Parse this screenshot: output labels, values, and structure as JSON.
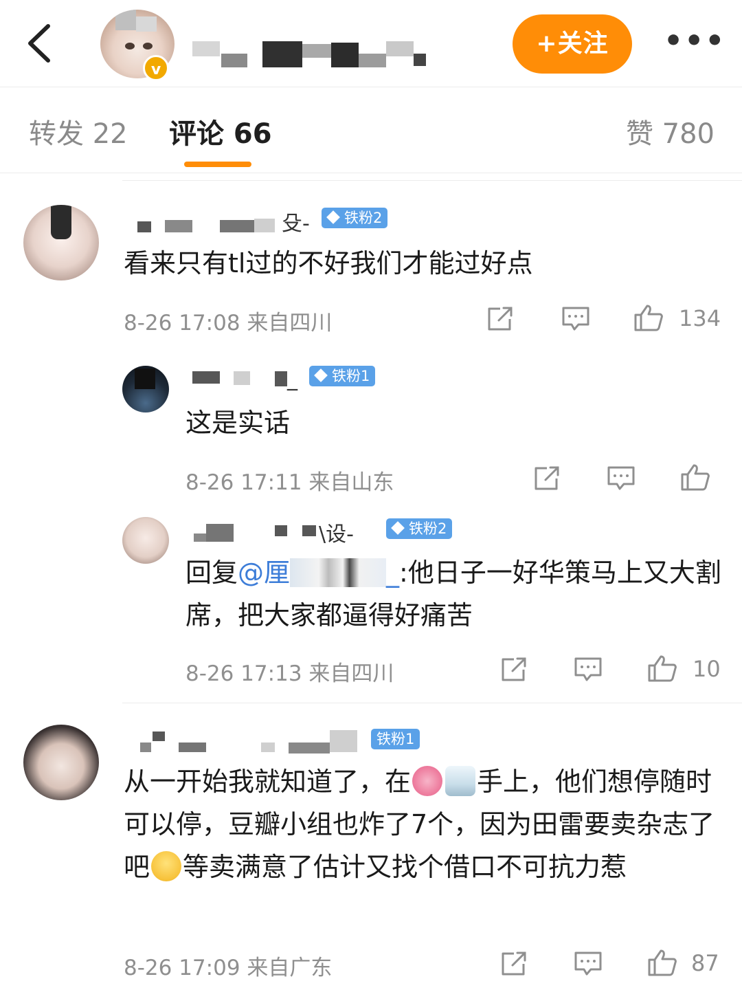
{
  "header": {
    "follow_label": "+关注",
    "more_label": "•••",
    "verified_mark": "v"
  },
  "tabs": [
    {
      "label": "转发 22"
    },
    {
      "label": "评论 66"
    },
    {
      "label": "赞 780"
    }
  ],
  "comments": [
    {
      "name_tail": "殳-",
      "badge": "铁粉2",
      "text": "看来只有tl过的不好我们才能过好点",
      "meta": "8-26 17:08 来自四川",
      "likes": "134",
      "replies": [
        {
          "name_tail": "_",
          "badge": "铁粉1",
          "text": "这是实话",
          "meta": "8-26 17:11 来自山东",
          "likes": ""
        },
        {
          "name_tail": "\\设-",
          "badge": "铁粉2",
          "text_prefix": "回复",
          "mention": "@厘",
          "mention_tail": "_",
          "text_body": ":他日子一好华策马上又大割席，把大家都逼得好痛苦",
          "meta": "8-26 17:13 来自四川",
          "likes": "10"
        }
      ]
    },
    {
      "name_tail": "",
      "badge": "铁粉1",
      "text_a": "从一开始我就知道了，在",
      "text_b": "手上，他们想停随时可以停，豆瓣小组也炸了7个，因为田雷要卖杂志了吧",
      "text_c": "等卖满意了估计又找个借口不可抗力惹",
      "meta": "8-26 17:09 来自广东",
      "likes": "87"
    }
  ],
  "icons": {
    "back": "chevron-left-icon",
    "more": "more-dots-icon",
    "repost": "share-icon",
    "comment": "comment-icon",
    "like": "thumbs-up-icon",
    "fan_badge": "diamond-icon"
  },
  "colors": {
    "accent": "#ff8d07",
    "fan_badge": "#5aa1e8",
    "mention": "#3d7dd8",
    "meta": "#8f8f8f"
  }
}
